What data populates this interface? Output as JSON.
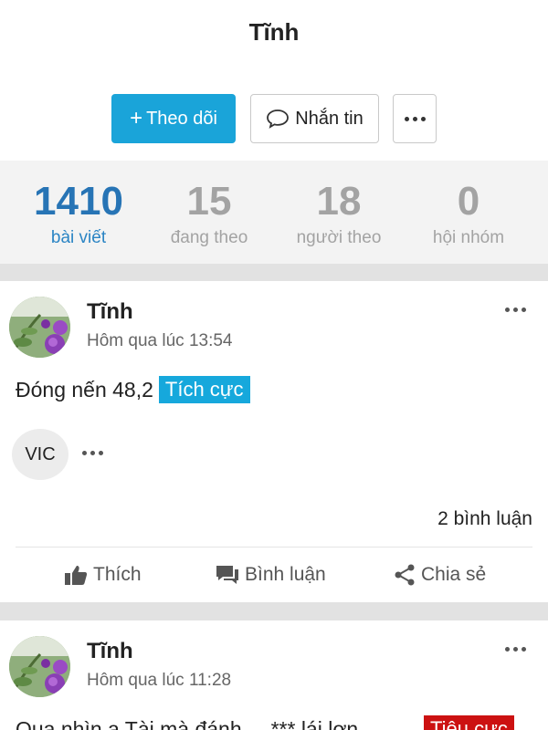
{
  "profile": {
    "name": "Tĩnh"
  },
  "actions": {
    "follow_label": "Theo dõi",
    "follow_icon": "+",
    "message_label": "Nhắn tin"
  },
  "stats": [
    {
      "value": "1410",
      "label": "bài viết",
      "active": true
    },
    {
      "value": "15",
      "label": "đang theo",
      "active": false
    },
    {
      "value": "18",
      "label": "người theo",
      "active": false
    },
    {
      "value": "0",
      "label": "hội nhóm",
      "active": false
    }
  ],
  "posts": [
    {
      "author": "Tĩnh",
      "time": "Hôm qua lúc 13:54",
      "text": "Đóng nến 48,2",
      "tag": "Tích cực",
      "ticker": "VIC",
      "comments": "2 bình luận"
    },
    {
      "author": "Tĩnh",
      "time": "Hôm qua lúc 11:28",
      "text": "Qua nhìn a Tài mà đánh ... *** lái lợn",
      "tag": "Tiêu cực"
    }
  ],
  "post_actions": {
    "like": "Thích",
    "comment": "Bình luận",
    "share": "Chia sẻ"
  },
  "colors": {
    "accent": "#1aa4d9",
    "positive": "#16a8dc",
    "negative": "#cc1111",
    "stat_active": "#2774b5"
  }
}
